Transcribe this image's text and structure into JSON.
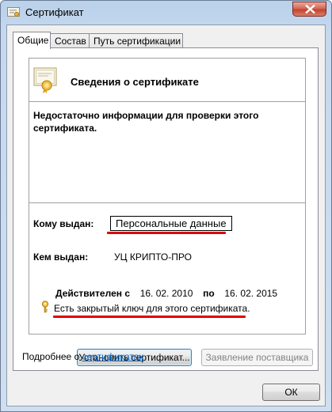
{
  "window": {
    "title": "Сертификат"
  },
  "tabs": [
    {
      "label": "Общие"
    },
    {
      "label": "Состав"
    },
    {
      "label": "Путь сертификации"
    }
  ],
  "info": {
    "title": "Сведения о сертификате",
    "warning": "Недостаточно информации для проверки этого сертификата."
  },
  "issued_to": {
    "label": "Кому выдан:",
    "value": "Персональные данные"
  },
  "issued_by": {
    "label": "Кем выдан:",
    "value": "УЦ КРИПТО-ПРО"
  },
  "validity": {
    "label": "Действителен с",
    "from": "16. 02. 2010",
    "to_label": "по",
    "to": "16. 02. 2015"
  },
  "private_key": {
    "text": "Есть закрытый ключ для этого сертификата."
  },
  "buttons": {
    "install": "Установить сертификат...",
    "issuer_statement": "Заявление поставщика",
    "ok": "ОК"
  },
  "more": {
    "prefix": "Подробнее о",
    "link": "сертификатах"
  },
  "colors": {
    "annotation_red": "#e00000",
    "link": "#0066cc"
  }
}
